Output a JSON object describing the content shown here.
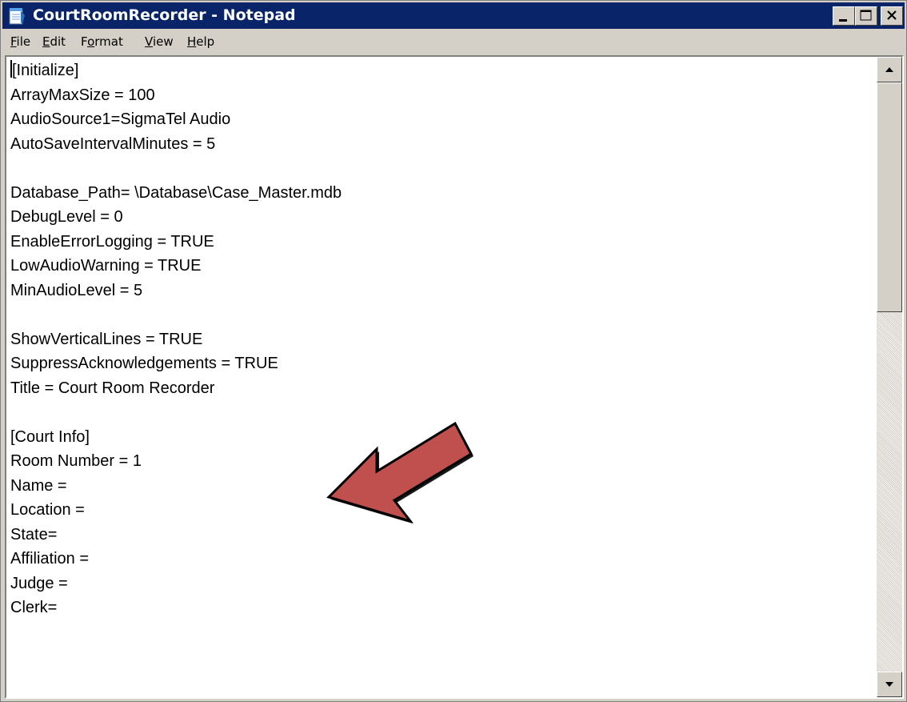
{
  "window": {
    "title": "CourtRoomRecorder - Notepad",
    "icon": "notepad-icon",
    "controls": [
      "minimize-icon",
      "maximize-icon",
      "close-icon"
    ]
  },
  "menu": {
    "file": {
      "mnemonic": "F",
      "rest": "ile"
    },
    "edit": {
      "mnemonic": "E",
      "rest": "dit"
    },
    "format": {
      "pre": "F",
      "mnemonic": "o",
      "rest": "rmat"
    },
    "view": {
      "mnemonic": "V",
      "rest": "iew"
    },
    "help": {
      "mnemonic": "H",
      "rest": "elp"
    }
  },
  "document": {
    "lines": [
      "[Initialize]",
      "ArrayMaxSize = 100",
      "AudioSource1=SigmaTel Audio",
      "AutoSaveIntervalMinutes = 5",
      "",
      "Database_Path= \\Database\\Case_Master.mdb",
      "DebugLevel = 0",
      "EnableErrorLogging = TRUE",
      "LowAudioWarning = TRUE",
      "MinAudioLevel = 5",
      "",
      "ShowVerticalLines = TRUE",
      "SuppressAcknowledgements = TRUE",
      "Title = Court Room Recorder",
      "",
      "[Court Info]",
      "Room Number = 1",
      "Name =",
      "Location =",
      "State=",
      "Affiliation =",
      "Judge =",
      "Clerk="
    ]
  },
  "annotation": {
    "icon": "red-arrow-icon",
    "color": "#c0504d",
    "outline": "#000000"
  },
  "colors": {
    "titlebar": "#0a246a",
    "chrome": "#d4d0c8"
  }
}
